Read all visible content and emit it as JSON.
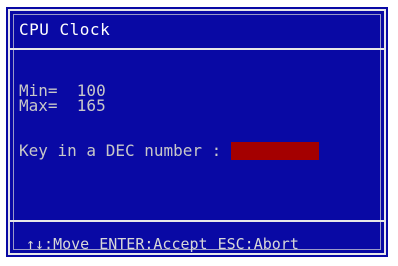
{
  "dialog": {
    "title": "CPU Clock",
    "min_label": "Min=",
    "min_value": "100",
    "max_label": "Max=",
    "max_value": "165",
    "prompt": "Key in a DEC number :",
    "input_value": ""
  },
  "footer": {
    "move": "↑↓:Move",
    "accept": "ENTER:Accept",
    "abort": "ESC:Abort"
  },
  "colors": {
    "dialog_bg": "#0909a4",
    "input_bg": "#a40000",
    "text": "#c8c8c8"
  }
}
